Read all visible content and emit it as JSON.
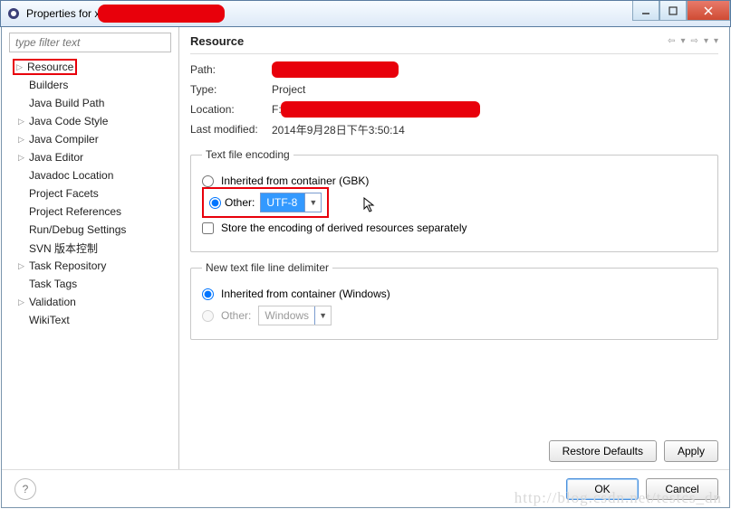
{
  "window": {
    "title_prefix": "Properties for x"
  },
  "nav": {
    "filter_placeholder": "type filter text",
    "items": [
      {
        "label": "Resource",
        "expandable": true,
        "selected": true
      },
      {
        "label": "Builders",
        "child": true
      },
      {
        "label": "Java Build Path",
        "child": true
      },
      {
        "label": "Java Code Style",
        "child": true,
        "expandable": true
      },
      {
        "label": "Java Compiler",
        "child": true,
        "expandable": true
      },
      {
        "label": "Java Editor",
        "child": true,
        "expandable": true
      },
      {
        "label": "Javadoc Location",
        "child": true
      },
      {
        "label": "Project Facets",
        "child": true
      },
      {
        "label": "Project References",
        "child": true
      },
      {
        "label": "Run/Debug Settings",
        "child": true
      },
      {
        "label": "SVN 版本控制",
        "child": true
      },
      {
        "label": "Task Repository",
        "child": true,
        "expandable": true
      },
      {
        "label": "Task Tags",
        "child": true
      },
      {
        "label": "Validation",
        "child": true,
        "expandable": true
      },
      {
        "label": "WikiText",
        "child": true
      }
    ]
  },
  "page": {
    "title": "Resource",
    "path_label": "Path:",
    "type_label": "Type:",
    "type_value": "Project",
    "location_label": "Location:",
    "location_prefix": "F:\\",
    "modified_label": "Last modified:",
    "modified_value": "2014年9月28日下午3:50:14",
    "encoding": {
      "legend": "Text file encoding",
      "inherited_label": "Inherited from container (GBK)",
      "other_label": "Other:",
      "other_value": "UTF-8",
      "store_label": "Store the encoding of derived resources separately"
    },
    "delimiter": {
      "legend": "New text file line delimiter",
      "inherited_label": "Inherited from container (Windows)",
      "other_label": "Other:",
      "other_value": "Windows"
    },
    "restore": "Restore Defaults",
    "apply": "Apply"
  },
  "footer": {
    "ok": "OK",
    "cancel": "Cancel"
  },
  "watermark": "http://blog.csdn.net/testcs_dn"
}
